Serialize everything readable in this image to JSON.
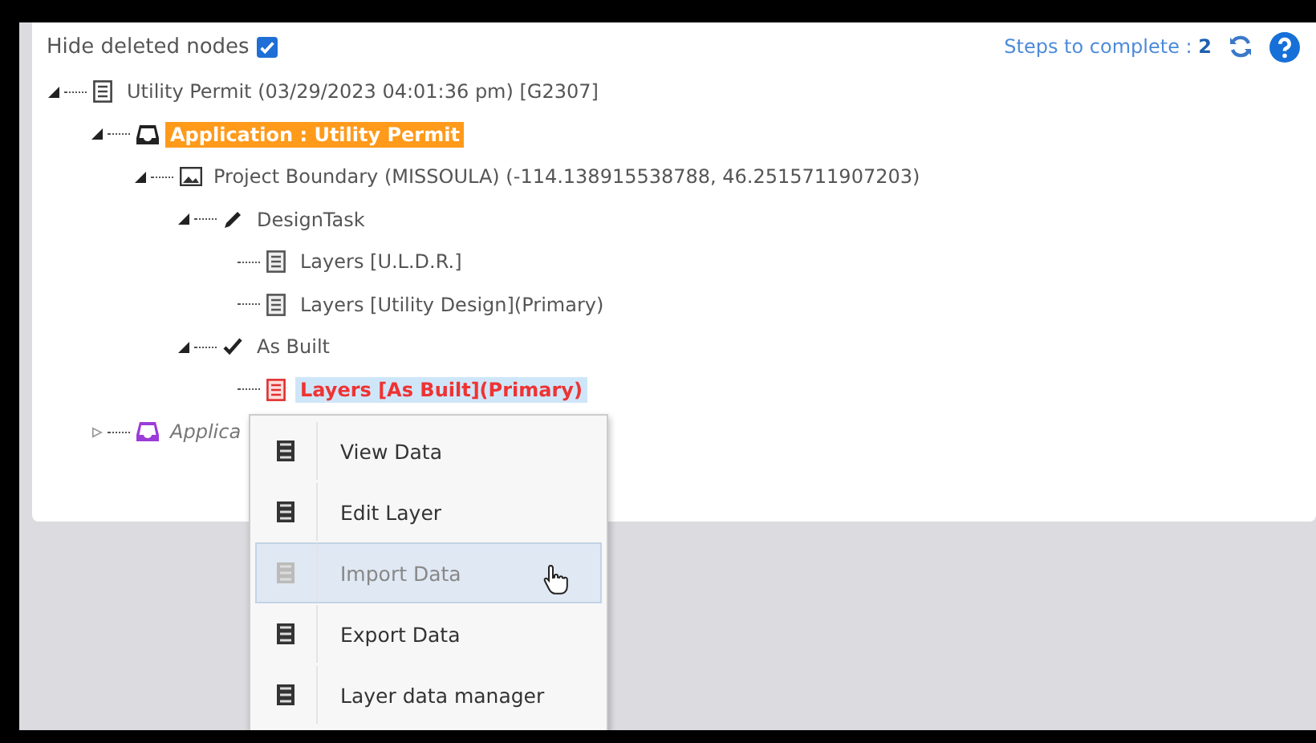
{
  "hide_deleted": {
    "label": "Hide deleted nodes",
    "checked": true
  },
  "steps": {
    "label": "Steps to complete :",
    "count": "2"
  },
  "tree": [
    {
      "kind": "list",
      "label": "Utility Permit (03/29/2023 04:01:36 pm) [G2307]",
      "expanded": true,
      "current": false,
      "selected": false,
      "deleted": false,
      "children": [
        {
          "kind": "application",
          "label": "Application : Utility Permit",
          "expanded": true,
          "current": true,
          "selected": false,
          "deleted": false,
          "children": [
            {
              "kind": "image",
              "label": "Project Boundary (MISSOULA) (-114.138915538788, 46.2515711907203)",
              "expanded": true,
              "current": false,
              "selected": false,
              "deleted": false,
              "children": [
                {
                  "kind": "pencil",
                  "label": "DesignTask",
                  "expanded": true,
                  "current": false,
                  "selected": false,
                  "deleted": false,
                  "children": [
                    {
                      "kind": "layer",
                      "label": "Layers [U.L.D.R.]",
                      "current": false,
                      "selected": false,
                      "deleted": false
                    },
                    {
                      "kind": "layer",
                      "label": "Layers [Utility Design](Primary)",
                      "current": false,
                      "selected": false,
                      "deleted": false
                    }
                  ]
                },
                {
                  "kind": "check",
                  "label": "As Built",
                  "expanded": true,
                  "current": false,
                  "selected": false,
                  "deleted": false,
                  "children": [
                    {
                      "kind": "layer",
                      "label": "Layers [As Built](Primary)",
                      "current": false,
                      "selected": true,
                      "deleted": false
                    }
                  ]
                }
              ]
            }
          ]
        },
        {
          "kind": "application",
          "label": "Applica",
          "expanded": false,
          "current": false,
          "selected": false,
          "deleted": true
        }
      ]
    }
  ],
  "context_menu": [
    {
      "label": "View Data",
      "selected": false
    },
    {
      "label": "Edit Layer",
      "selected": false
    },
    {
      "label": "Import Data",
      "selected": true
    },
    {
      "label": "Export Data",
      "selected": false
    },
    {
      "label": "Layer data manager",
      "selected": false
    }
  ]
}
